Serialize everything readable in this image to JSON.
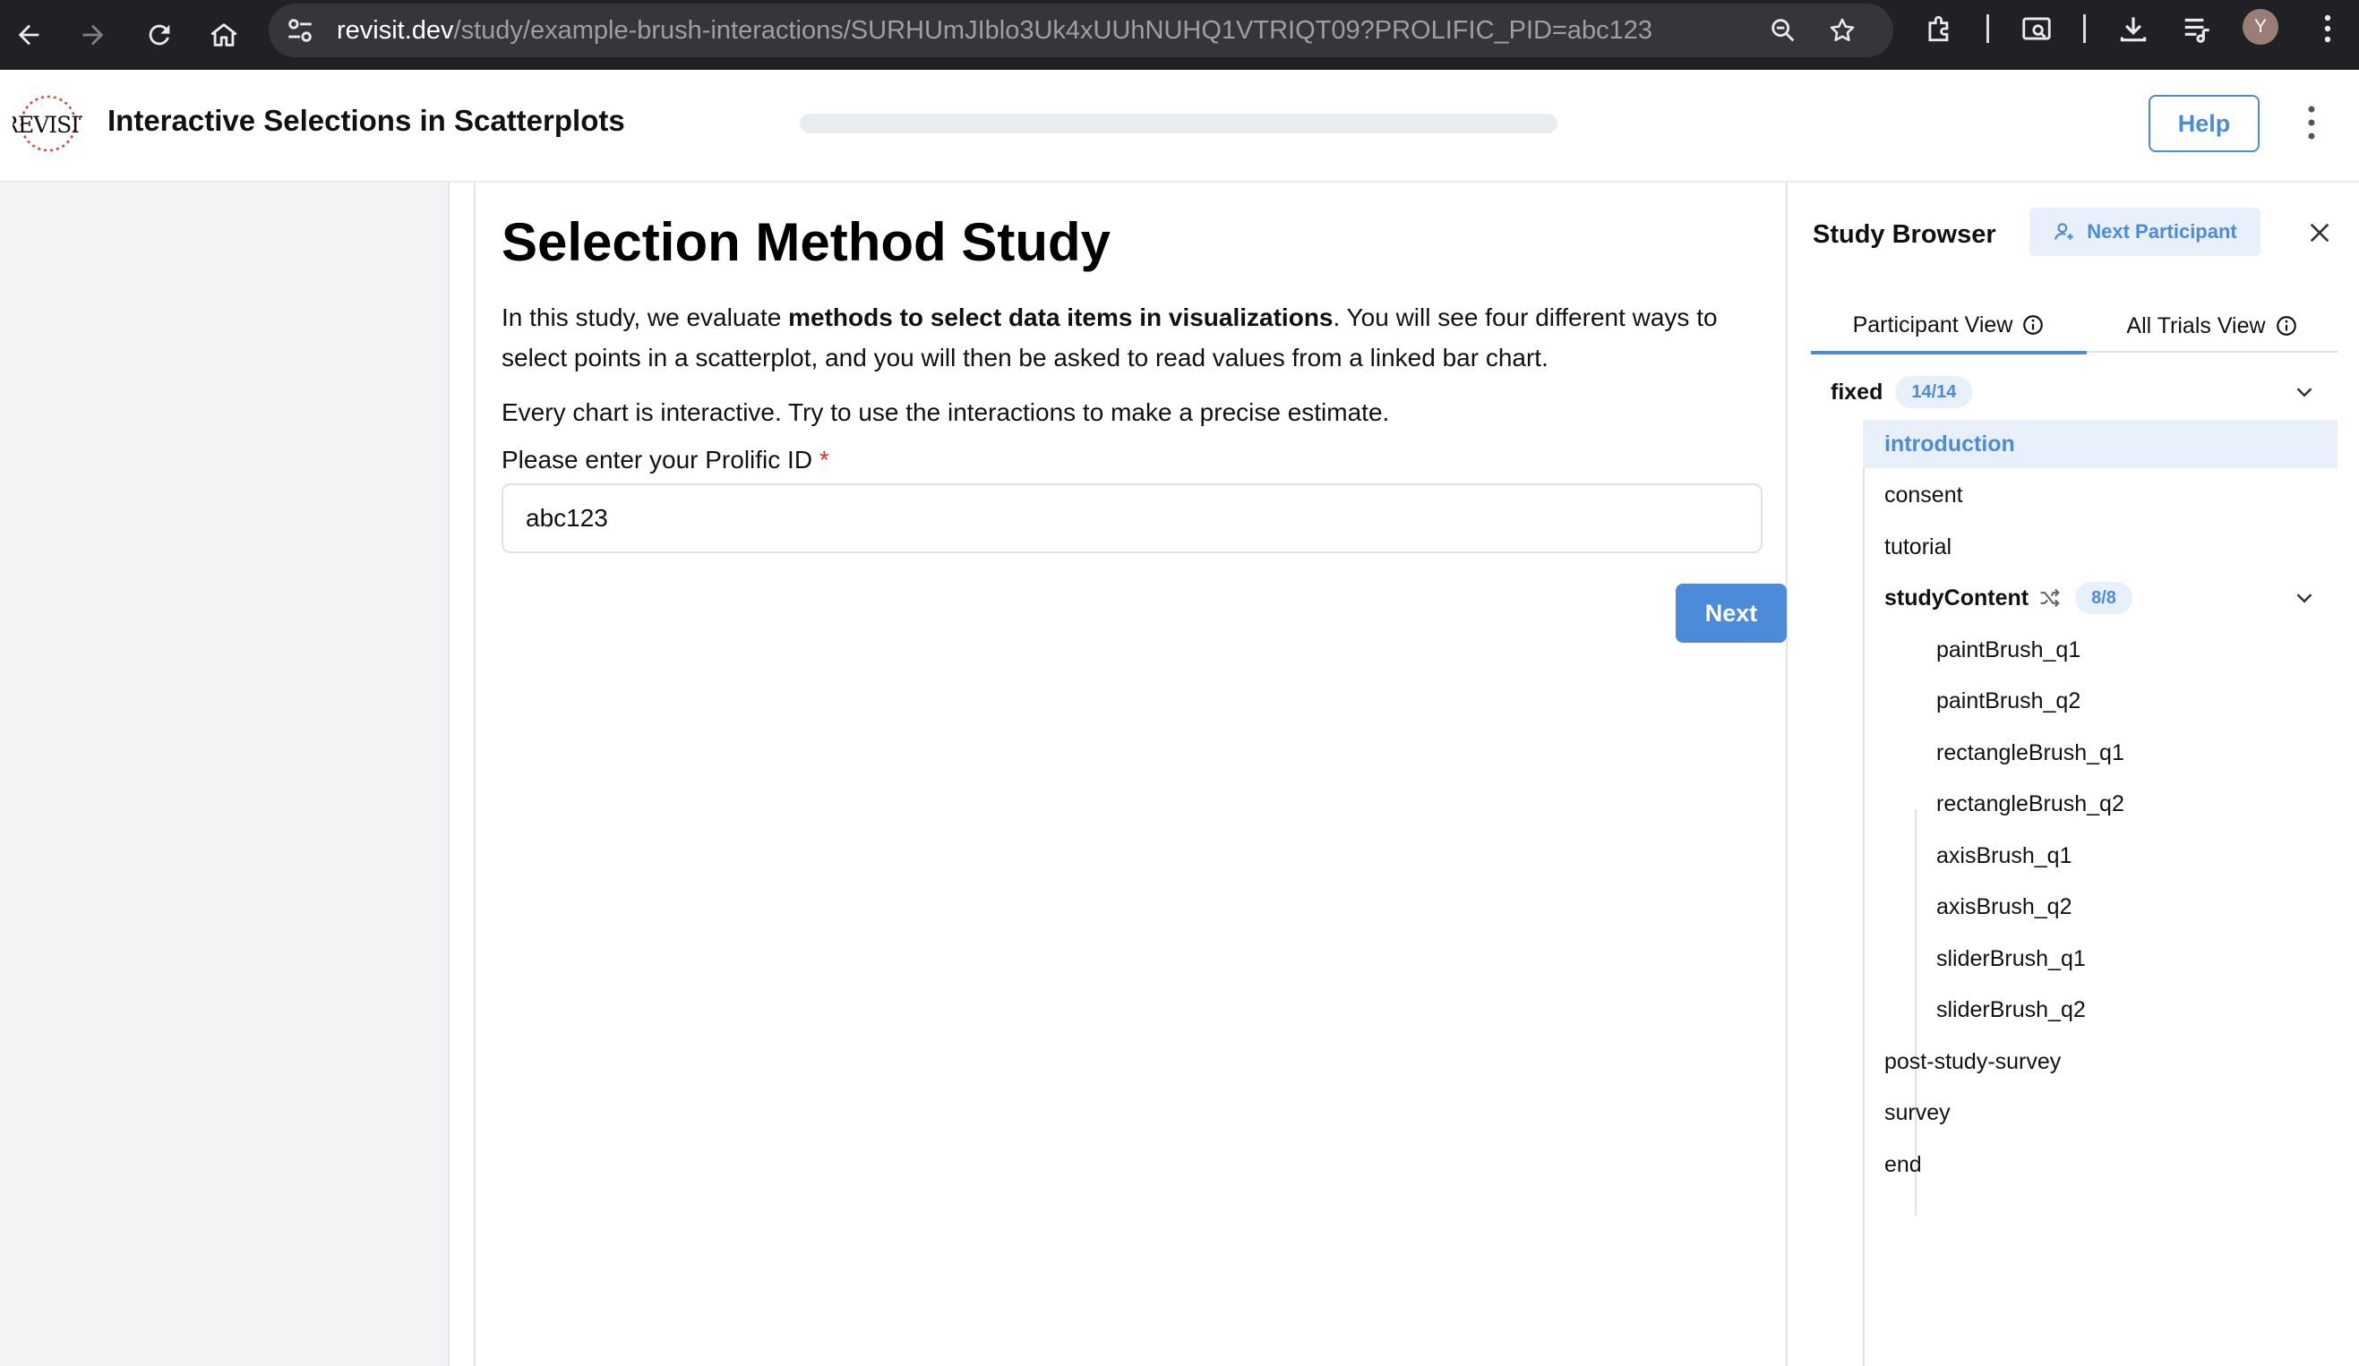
{
  "browser": {
    "url_host": "revisit.dev",
    "url_path": "/study/example-brush-interactions/SURHUmJIblo3Uk4xUUhNUHQ1VTRIQT09?PROLIFIC_PID=abc123",
    "profile_initial": "Y"
  },
  "header": {
    "logo_text": "REVISIT",
    "title": "Interactive Selections in Scatterplots",
    "progress_fraction": 0,
    "help_label": "Help"
  },
  "main": {
    "title": "Selection Method Study",
    "intro_before": "In this study, we evaluate ",
    "intro_bold": "methods to select data items in visualizations",
    "intro_after": ". You will see four different ways to select points in a scatterplot, and you will then be asked to read values from a linked bar chart.",
    "instruction": "Every chart is interactive. Try to use the interactions to make a precise estimate.",
    "field_label": "Please enter your Prolific ID",
    "required_mark": "*",
    "field_value": "abc123",
    "next_label": "Next"
  },
  "study_browser": {
    "title": "Study Browser",
    "next_participant_label": "Next Participant",
    "tabs": [
      {
        "label": "Participant View",
        "active": true
      },
      {
        "label": "All Trials View",
        "active": false
      }
    ],
    "tree": {
      "root_label": "fixed",
      "root_badge": "14/14",
      "items": [
        "introduction",
        "consent",
        "tutorial"
      ],
      "selected": "introduction",
      "group_label": "studyContent",
      "group_badge": "8/8",
      "group_items": [
        "paintBrush_q1",
        "paintBrush_q2",
        "rectangleBrush_q1",
        "rectangleBrush_q2",
        "axisBrush_q1",
        "axisBrush_q2",
        "sliderBrush_q1",
        "sliderBrush_q2"
      ],
      "after_items": [
        "post-study-survey",
        "survey",
        "end"
      ]
    }
  },
  "colors": {
    "accent": "#4c8bd9",
    "accent_light": "#e7f0fb",
    "required": "#e03131",
    "chrome_bg": "#202124"
  }
}
